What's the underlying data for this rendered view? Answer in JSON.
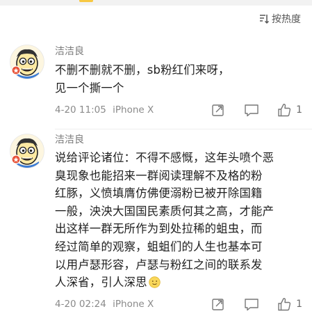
{
  "sort": {
    "label": "按热度",
    "icon": "sort-icon"
  },
  "comments": [
    {
      "username": "洁洁良",
      "avatar_icon": "cartoon-avatar-icon",
      "text": "不删不删就不删，sb粉红们来呀，\n见一个撕一个",
      "date": "4-20 11:05",
      "device": "iPhone X",
      "like_count": "1",
      "actions": {
        "share_icon": "share-icon",
        "comment_icon": "comment-icon",
        "like_icon": "thumbs-up-icon"
      }
    },
    {
      "username": "洁洁良",
      "avatar_icon": "cartoon-avatar-icon",
      "text": "说给评论诸位：不得不感慨，这年头喷个恶\n臭现象也能招来一群阅读理解不及格的粉\n红豚，义愤填膺仿佛便溺粉已被开除国籍\n一般，泱泱大国国民素质何其之高，才能产\n出这样一群无所作为到处拉稀的蛆虫，而\n经过简单的观察，蛆蛆们的人生也基本可\n以用卢瑟形容，卢瑟与粉红之间的联系发\n人深省，引人深思",
      "emoji_icon": "slight-smile-emoji-icon",
      "date": "4-20 02:24",
      "device": "iPhone X",
      "like_count": "1",
      "actions": {
        "share_icon": "share-icon",
        "comment_icon": "comment-icon",
        "like_icon": "thumbs-up-icon"
      }
    }
  ],
  "colors": {
    "text": "#1f1f1f",
    "meta": "#8a8a8a",
    "username": "#7a7a7a",
    "accent": "#f7c843",
    "badge": "#e8543a"
  }
}
